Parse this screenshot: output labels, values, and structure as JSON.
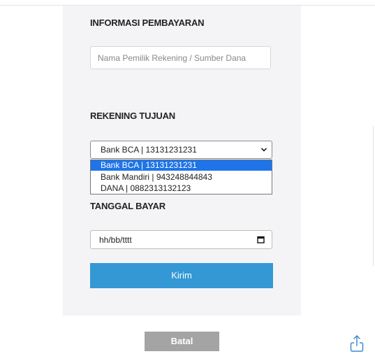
{
  "payment_info": {
    "heading": "INFORMASI PEMBAYARAN",
    "name_placeholder": "Nama Pemilik Rekening / Sumber Dana"
  },
  "destination": {
    "heading": "REKENING TUJUAN",
    "selected": "Bank BCA | 13131231231",
    "options": [
      "Bank BCA | 13131231231",
      "Bank Mandiri | 943248844843",
      "DANA | 0882313132123"
    ]
  },
  "payment_date": {
    "heading": "TANGGAL BAYAR",
    "placeholder": "hh/bb/tttt"
  },
  "actions": {
    "submit_label": "Kirim",
    "cancel_label": "Batal"
  },
  "icons": {
    "dropdown": "chevron-down-icon",
    "date": "calendar-icon",
    "share": "share-icon"
  },
  "colors": {
    "accent": "#3498d4",
    "selected_option": "#1e74e8",
    "cancel": "#a4a4a4"
  }
}
